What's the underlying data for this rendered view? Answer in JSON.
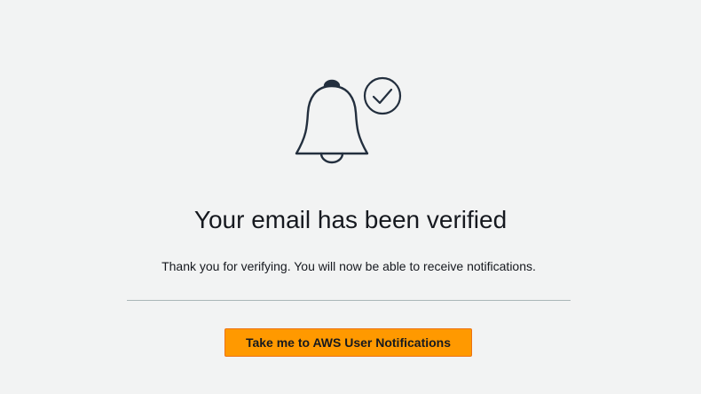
{
  "illustration": {
    "main_icon": "bell-icon",
    "badge_icon": "check-circle-icon",
    "stroke_color": "#232f3e"
  },
  "content": {
    "title": "Your email has been verified",
    "message": "Thank you for verifying. You will now be able to receive notifications."
  },
  "actions": {
    "primary_button_label": "Take me to AWS User Notifications",
    "primary_button_color": "#ff9900"
  },
  "colors": {
    "background": "#f2f3f3",
    "text": "#16191f",
    "divider": "#aab7b8"
  }
}
